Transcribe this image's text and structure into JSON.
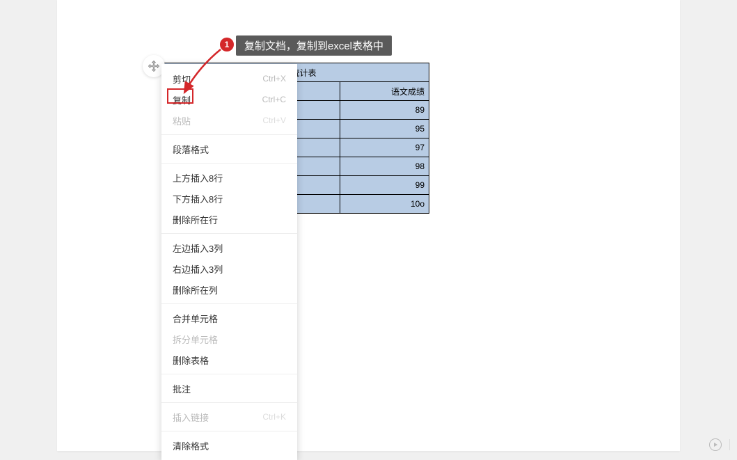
{
  "annotation": {
    "badge": "1",
    "tooltip": "复制文档，复制到excel表格中"
  },
  "table": {
    "title": "成绩统计表",
    "col_header": "语文成绩",
    "rows": [
      "89",
      "95",
      "97",
      "98",
      "99",
      "10o"
    ]
  },
  "menu": {
    "cut": {
      "label": "剪切",
      "shortcut": "Ctrl+X"
    },
    "copy": {
      "label": "复制",
      "shortcut": "Ctrl+C"
    },
    "paste": {
      "label": "粘贴",
      "shortcut": "Ctrl+V"
    },
    "paragraph_format": "段落格式",
    "insert_rows_above": "上方插入8行",
    "insert_rows_below": "下方插入8行",
    "delete_row": "删除所在行",
    "insert_cols_left": "左边插入3列",
    "insert_cols_right": "右边插入3列",
    "delete_col": "删除所在列",
    "merge_cells": "合并单元格",
    "split_cells": "拆分单元格",
    "delete_table": "删除表格",
    "comment": "批注",
    "insert_link": {
      "label": "插入链接",
      "shortcut": "Ctrl+K"
    },
    "clear_format": "清除格式"
  }
}
